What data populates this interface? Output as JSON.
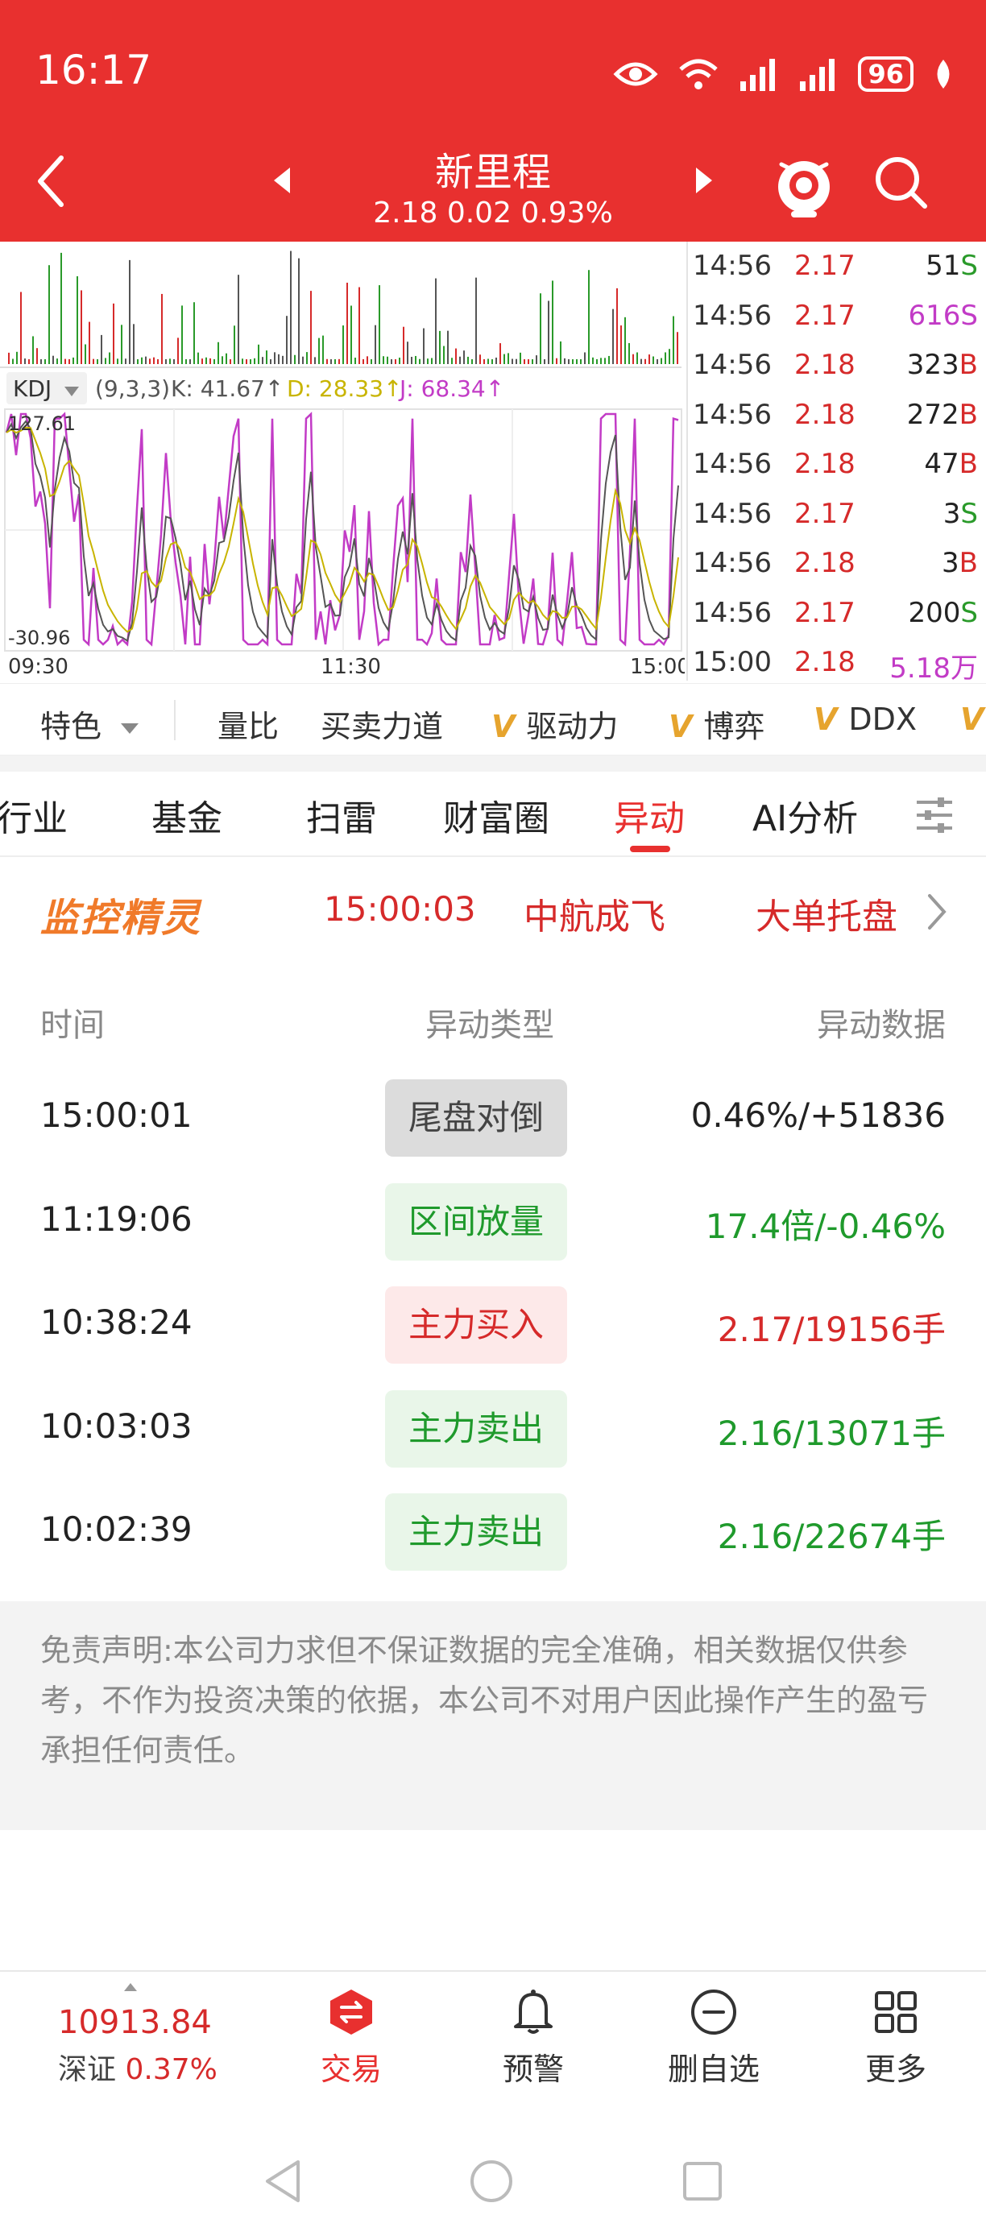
{
  "status_bar": {
    "time": "16:17",
    "battery": "96"
  },
  "header": {
    "name": "新里程",
    "quote": "2.18 0.02 0.93%",
    "accent": "#e8302f"
  },
  "chart": {
    "indicator_label": "KDJ",
    "params": "(9,3,3)",
    "k": "K: 41.67↑",
    "d": "D: 28.33↑",
    "j": "J: 68.34↑",
    "y_max": "127.61",
    "y_min": "-30.96",
    "times": [
      "09:30",
      "11:30",
      "15:00"
    ]
  },
  "ticks": [
    {
      "time": "14:56",
      "price": "2.17",
      "vol": "51",
      "side": "S",
      "price_color": "red",
      "vol_color": "dark",
      "side_color": "green"
    },
    {
      "time": "14:56",
      "price": "2.17",
      "vol": "616",
      "side": "S",
      "price_color": "red",
      "vol_color": "purple",
      "side_color": "purple"
    },
    {
      "time": "14:56",
      "price": "2.18",
      "vol": "323",
      "side": "B",
      "price_color": "red",
      "vol_color": "dark",
      "side_color": "red"
    },
    {
      "time": "14:56",
      "price": "2.18",
      "vol": "272",
      "side": "B",
      "price_color": "red",
      "vol_color": "dark",
      "side_color": "red"
    },
    {
      "time": "14:56",
      "price": "2.18",
      "vol": "47",
      "side": "B",
      "price_color": "red",
      "vol_color": "dark",
      "side_color": "red"
    },
    {
      "time": "14:56",
      "price": "2.17",
      "vol": "3",
      "side": "S",
      "price_color": "red",
      "vol_color": "dark",
      "side_color": "green"
    },
    {
      "time": "14:56",
      "price": "2.18",
      "vol": "3",
      "side": "B",
      "price_color": "red",
      "vol_color": "dark",
      "side_color": "red"
    },
    {
      "time": "14:56",
      "price": "2.17",
      "vol": "200",
      "side": "S",
      "price_color": "red",
      "vol_color": "dark",
      "side_color": "green"
    },
    {
      "time": "15:00",
      "price": "2.18",
      "vol": "5.18万",
      "side": "",
      "price_color": "red",
      "vol_color": "purple",
      "side_color": "purple"
    }
  ],
  "indicator_tabs": {
    "special": "特色",
    "items": [
      "量比",
      "买卖力道",
      "驱动力",
      "博弈",
      "DDX"
    ],
    "v_mark": "V"
  },
  "category_tabs": [
    "行业",
    "基金",
    "扫雷",
    "财富圈",
    "异动",
    "AI分析"
  ],
  "active_category": "异动",
  "monitor": {
    "logo": "监控精灵",
    "time": "15:00:03",
    "stock": "中航成飞",
    "event": "大单托盘"
  },
  "table": {
    "headers": {
      "time": "时间",
      "type": "异动类型",
      "data": "异动数据"
    },
    "rows": [
      {
        "time": "15:00:01",
        "type": "尾盘对倒",
        "data": "0.46%/+51836",
        "style": "gray"
      },
      {
        "time": "11:19:06",
        "type": "区间放量",
        "data": "17.4倍/-0.46%",
        "style": "green"
      },
      {
        "time": "10:38:24",
        "type": "主力买入",
        "data": "2.17/19156手",
        "style": "red"
      },
      {
        "time": "10:03:03",
        "type": "主力卖出",
        "data": "2.16/13071手",
        "style": "green"
      },
      {
        "time": "10:02:39",
        "type": "主力卖出",
        "data": "2.16/22674手",
        "style": "green"
      }
    ]
  },
  "disclaimer": "免责声明:本公司力求但不保证数据的完全准确，相关数据仅供参考，不作为投资决策的依据，本公司不对用户因此操作产生的盈亏承担任何责任。",
  "bottom_nav": {
    "index_value": "10913.84",
    "index_name": "深证",
    "index_pct": "0.37%",
    "items": [
      "交易",
      "预警",
      "删自选",
      "更多"
    ]
  }
}
